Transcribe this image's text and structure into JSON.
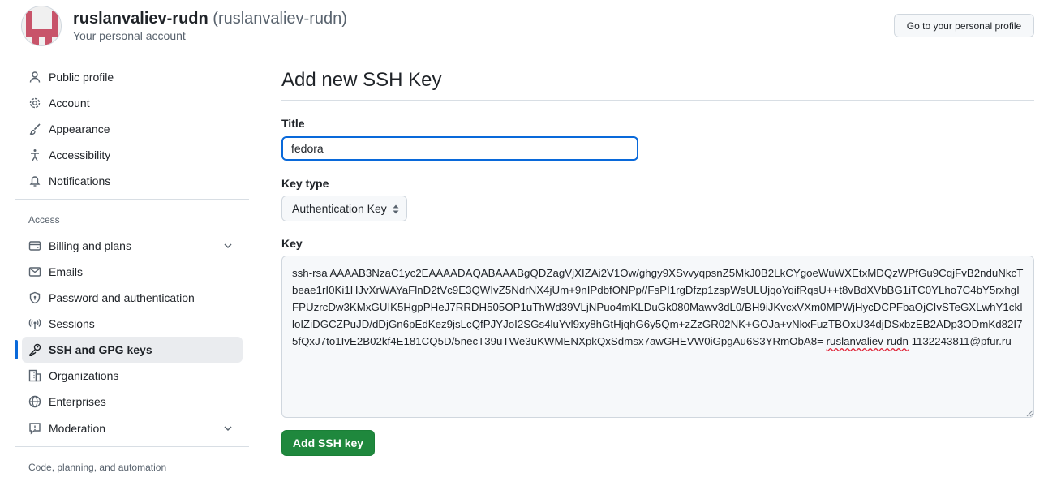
{
  "header": {
    "login": "ruslanvaliev-rudn",
    "name_paren": "(ruslanvaliev-rudn)",
    "subtitle": "Your personal account",
    "profile_button": "Go to your personal profile"
  },
  "sidebar": {
    "top_items": [
      {
        "label": "Public profile",
        "icon": "person-icon"
      },
      {
        "label": "Account",
        "icon": "gear-icon"
      },
      {
        "label": "Appearance",
        "icon": "paintbrush-icon"
      },
      {
        "label": "Accessibility",
        "icon": "accessibility-icon"
      },
      {
        "label": "Notifications",
        "icon": "bell-icon"
      }
    ],
    "access_heading": "Access",
    "access_items": [
      {
        "label": "Billing and plans",
        "icon": "credit-card-icon",
        "expandable": true
      },
      {
        "label": "Emails",
        "icon": "mail-icon"
      },
      {
        "label": "Password and authentication",
        "icon": "shield-lock-icon"
      },
      {
        "label": "Sessions",
        "icon": "broadcast-icon"
      },
      {
        "label": "SSH and GPG keys",
        "icon": "key-icon",
        "active": true
      },
      {
        "label": "Organizations",
        "icon": "organization-icon"
      },
      {
        "label": "Enterprises",
        "icon": "globe-icon"
      },
      {
        "label": "Moderation",
        "icon": "report-icon",
        "expandable": true
      }
    ],
    "code_heading": "Code, planning, and automation"
  },
  "main": {
    "title": "Add new SSH Key",
    "title_label": "Title",
    "title_value": "fedora",
    "key_type_label": "Key type",
    "key_type_value": "Authentication Key",
    "key_label": "Key",
    "key_value_prefix": "ssh-rsa AAAAB3NzaC1yc2EAAAADAQABAAABgQDZagVjXIZAi2V1Ow/ghgy9XSvvyqpsnZ5MkJ0B2LkCYgoeWuWXEtxMDQzWPfGu9CqjFvB2nduNkcTbeae1rI0Ki1HJvXrWAYaFlnD2tVc9E3QWIvZ5NdrNX4jUm+9nIPdbfONPp//FsPI1rgDfzp1zspWsULUjqoYqifRqsU++t8vBdXVbBG1iTC0YLho7C4bY5rxhgIFPUzrcDw3KMxGUIK5HgpPHeJ7RRDH505OP1uThWd39VLjNPuo4mKLDuGk080Mawv3dL0/BH9iJKvcxVXm0MPWjHycDCPFbaOjCIvSTeGXLwhY1ckIloIZiDGCZPuJD/dDjGn6pEdKez9jsLcQfPJYJoI2SGs4luYvl9xy8hGtHjqhG6y5Qm+zZzGR02NK+GOJa+vNkxFuzTBOxU34djDSxbzEB2ADp3ODmKd82I75fQxJ7to1IvE2B02kf4E181CQ5D/5necT39uTWe3uKWMENXpkQxSdmsx7awGHEVW0iGpgAu6S3YRmObA8= ",
    "key_value_user": "ruslanvaliev-rudn",
    "key_value_suffix": " 1132243811@pfur.ru",
    "submit_button": "Add SSH key"
  },
  "colors": {
    "accent_blue": "#0969da",
    "primary_green": "#1f883d",
    "avatar_pink": "#c8546a"
  }
}
